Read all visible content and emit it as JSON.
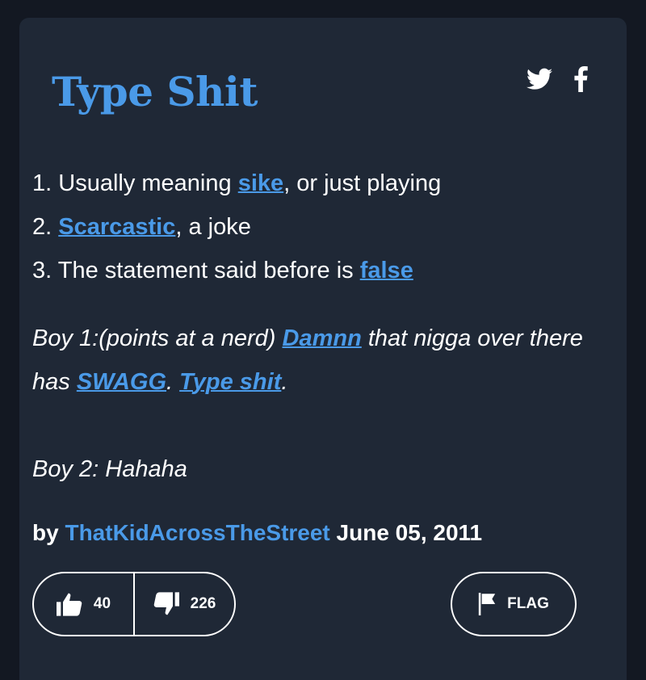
{
  "entry": {
    "title": "Type Shit",
    "definitions": [
      {
        "num": "1.",
        "before": "Usually meaning ",
        "link": "sike",
        "after": ", or just playing"
      },
      {
        "num": "2.",
        "before": "",
        "link": "Scarcastic",
        "after": ", a joke"
      },
      {
        "num": "3.",
        "before": "The statement said before is ",
        "link": "false",
        "after": ""
      }
    ],
    "example": {
      "line1_a": "Boy 1:(points at a nerd) ",
      "link1": "Damnn",
      "line1_b": " that nigga over there has ",
      "link2": "SWAGG",
      "sep": ". ",
      "link3": "Type shit",
      "end": ".",
      "line2": "Boy 2: Hahaha"
    },
    "author": {
      "by": "by",
      "name": "ThatKidAcrossTheStreet",
      "date": "June 05, 2011"
    },
    "votes": {
      "up": "40",
      "down": "226"
    },
    "flag_label": "FLAG"
  },
  "icons": {
    "twitter": "twitter-icon",
    "facebook": "facebook-icon",
    "thumbs_up": "thumbs-up-icon",
    "thumbs_down": "thumbs-down-icon",
    "flag": "flag-icon"
  },
  "colors": {
    "background": "#131822",
    "card": "#1f2836",
    "accent": "#4a9ae8",
    "text": "#ffffff"
  }
}
